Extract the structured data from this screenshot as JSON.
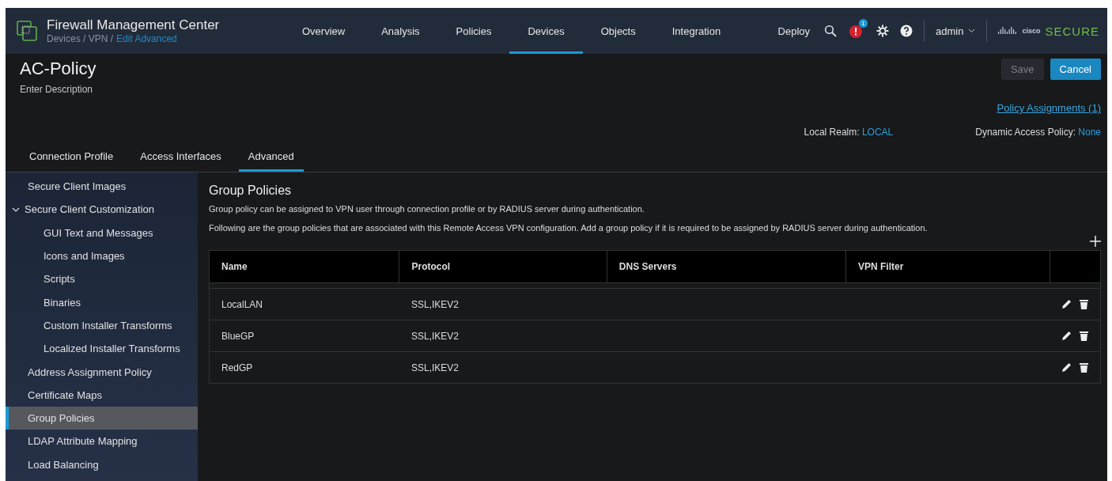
{
  "header": {
    "product": "Firewall Management Center",
    "breadcrumb": "Devices / VPN /",
    "breadcrumb_current": "Edit Advanced",
    "nav": [
      {
        "label": "Overview",
        "selected": false
      },
      {
        "label": "Analysis",
        "selected": false
      },
      {
        "label": "Policies",
        "selected": false
      },
      {
        "label": "Devices",
        "selected": true
      },
      {
        "label": "Objects",
        "selected": false
      },
      {
        "label": "Integration",
        "selected": false
      }
    ],
    "deploy": "Deploy",
    "notification_count": "1",
    "user": "admin",
    "brand_small": "cisco",
    "brand": "SECURE"
  },
  "policy": {
    "title": "AC-Policy",
    "description": "Enter Description",
    "buttons": [
      {
        "label": "Save",
        "disabled": true
      },
      {
        "label": "Cancel",
        "disabled": false
      }
    ],
    "assignments_link": "Policy Assignments (1)",
    "realm_label": "Local Realm:",
    "realm_value": "LOCAL",
    "dap_label": "Dynamic Access Policy:",
    "dap_value": "None"
  },
  "tabs": [
    {
      "label": "Connection Profile",
      "selected": false
    },
    {
      "label": "Access Interfaces",
      "selected": false
    },
    {
      "label": "Advanced",
      "selected": true
    }
  ],
  "sidebar": {
    "items": [
      {
        "label": "Secure Client Images",
        "selected": false
      },
      {
        "label": "Secure Client Customization",
        "selected": false,
        "expanded": true,
        "children": [
          {
            "label": "GUI Text and Messages",
            "selected": false
          },
          {
            "label": "Icons and Images",
            "selected": false
          },
          {
            "label": "Scripts",
            "selected": false
          },
          {
            "label": "Binaries",
            "selected": false
          },
          {
            "label": "Custom Installer Transforms",
            "selected": false
          },
          {
            "label": "Localized Installer Transforms",
            "selected": false
          }
        ]
      },
      {
        "label": "Address Assignment Policy",
        "selected": false
      },
      {
        "label": "Certificate Maps",
        "selected": false
      },
      {
        "label": "Group Policies",
        "selected": true
      },
      {
        "label": "LDAP Attribute Mapping",
        "selected": false
      },
      {
        "label": "Load Balancing",
        "selected": false
      }
    ]
  },
  "content": {
    "title": "Group Policies",
    "paragraphs": [
      "Group policy can be assigned to VPN user through connection profile or by RADIUS server during authentication.",
      "Following are the group policies that are associated with this Remote Access VPN configuration. Add a group policy if it is required to be assigned by RADIUS server during authentication."
    ],
    "table": {
      "columns": [
        "Name",
        "Protocol",
        "DNS Servers",
        "VPN Filter"
      ],
      "rows": [
        {
          "name": "LocalLAN",
          "protocol": "SSL,IKEV2"
        },
        {
          "name": "BlueGP",
          "protocol": "SSL,IKEV2"
        },
        {
          "name": "RedGP",
          "protocol": "SSL,IKEV2"
        }
      ]
    }
  }
}
